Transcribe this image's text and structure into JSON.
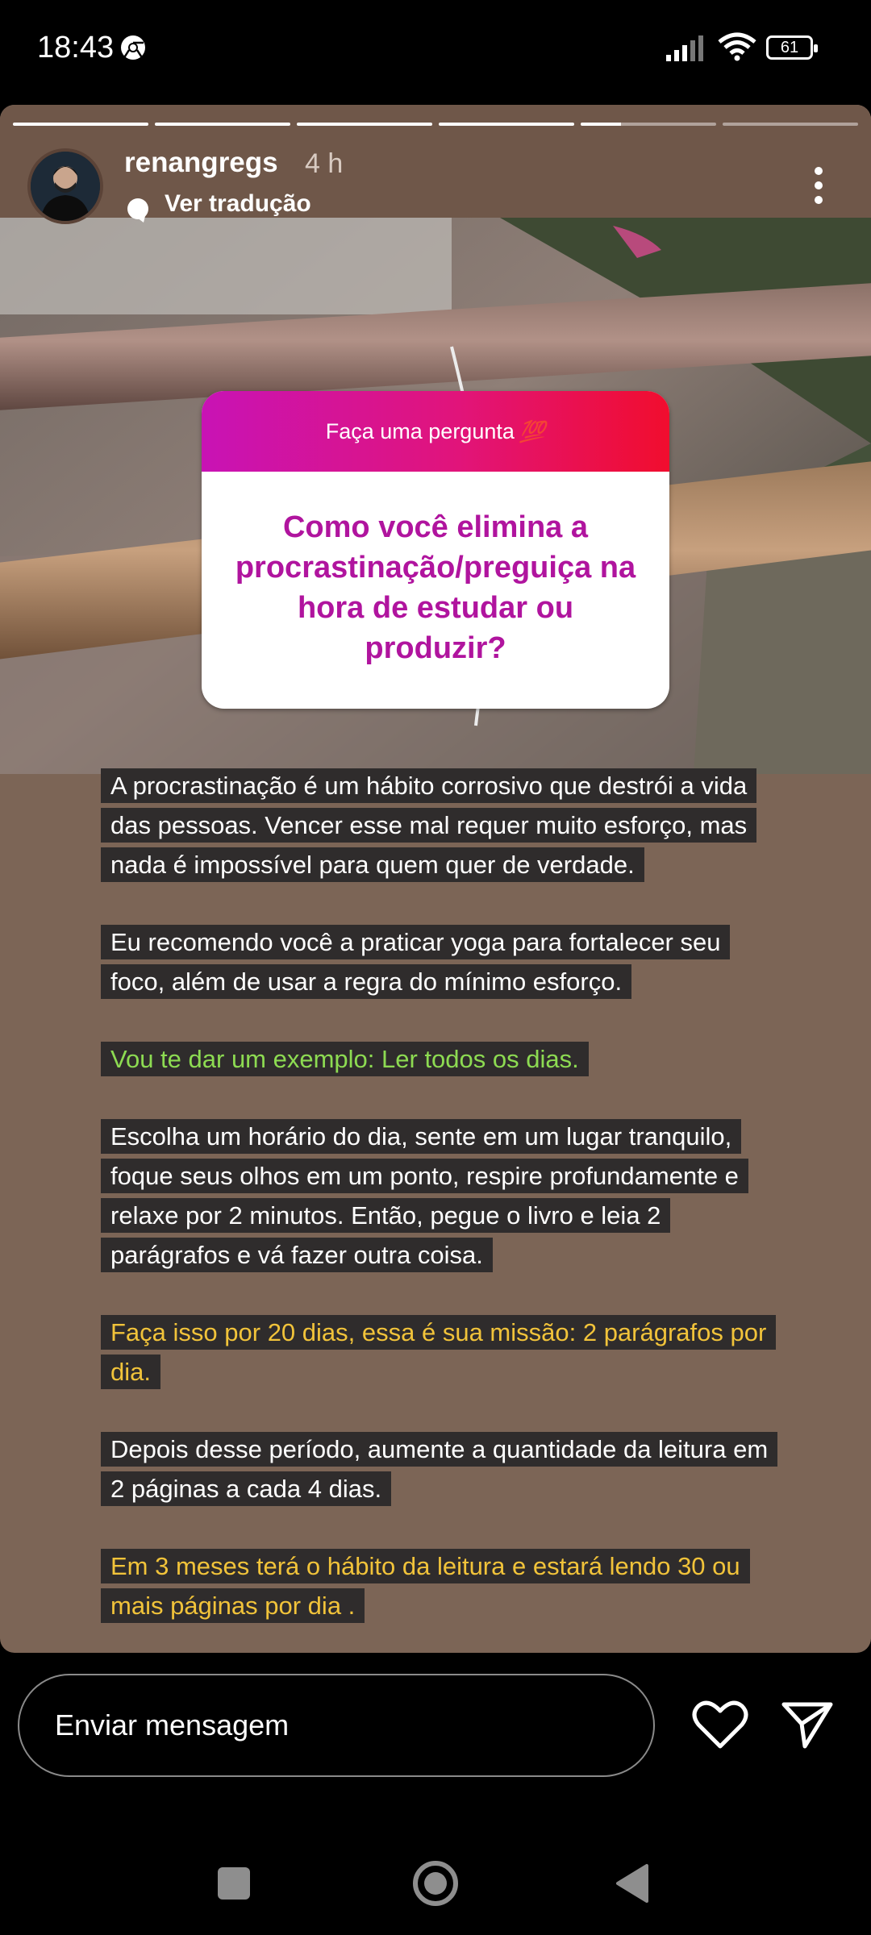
{
  "status_bar": {
    "time": "18:43",
    "battery": "61"
  },
  "story": {
    "progress_fractions": [
      1,
      1,
      1,
      1,
      0.3,
      0
    ],
    "username": "renangregs",
    "time_ago": "4 h",
    "translate_label": "Ver tradução",
    "question_sticker": {
      "title": "Faça uma pergunta",
      "title_emoji": "💯",
      "question": "Como você elimina a procrastinação/preguiça na hora de estudar ou produzir?"
    },
    "paragraphs": [
      {
        "text": "A procrastinação é um hábito corrosivo que destrói a vida das pessoas. Vencer esse mal requer muito esforço, mas nada é impossível para quem quer de verdade.",
        "color": "#ffffff"
      },
      {
        "text": "Eu recomendo você a praticar yoga para fortalecer seu foco, além de usar a regra do mínimo esforço.",
        "color": "#ffffff"
      },
      {
        "text": "Vou te dar um exemplo: Ler todos os dias.",
        "color": "#8ddb52"
      },
      {
        "text": "Escolha um horário do dia, sente em um lugar tranquilo, foque seus olhos em um ponto, respire profundamente e relaxe por 2 minutos. Então, pegue o livro e leia 2 parágrafos e vá fazer outra coisa.",
        "color": "#ffffff"
      },
      {
        "text": "Faça isso por 20 dias, essa é sua missão: 2 parágrafos por dia.",
        "color": "#f1c33a"
      },
      {
        "text": "Depois desse período, aumente a quantidade da leitura em 2 páginas a cada 4 dias.",
        "color": "#ffffff"
      },
      {
        "text": "Em 3 meses terá o hábito da leitura e estará lendo 30 ou mais páginas por dia .",
        "color": "#f1c33a"
      }
    ]
  },
  "reply_bar": {
    "placeholder": "Enviar mensagem"
  },
  "icons": [
    "chrome-icon",
    "signal-icon",
    "wifi-icon",
    "battery-icon",
    "translate-icon",
    "more-icon",
    "heart-icon",
    "send-icon",
    "recent-apps-icon",
    "home-icon",
    "back-icon"
  ]
}
